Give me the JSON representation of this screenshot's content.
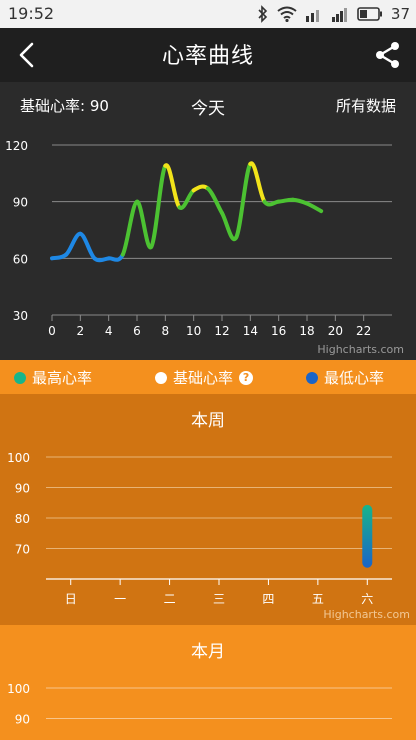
{
  "status": {
    "time": "19:52",
    "battery": "37"
  },
  "header": {
    "title": "心率曲线"
  },
  "summary": {
    "base_label": "基础心率: 90",
    "today_label": "今天",
    "all_data_label": "所有数据"
  },
  "legend": {
    "max_label": "最高心率",
    "base_label": "基础心率",
    "min_label": "最低心率",
    "help_glyph": "?"
  },
  "credits": {
    "text": "Highcharts.com"
  },
  "colors": {
    "accent": "#f4901e",
    "max": "#18b58a",
    "min": "#1a64c8",
    "line_blue": "#1e88e5",
    "line_green": "#4cc232",
    "line_yellow": "#f2e31a"
  },
  "chart_data": [
    {
      "type": "line",
      "title": "",
      "xlabel": "",
      "ylabel": "",
      "xlim": [
        0,
        24
      ],
      "ylim": [
        30,
        120
      ],
      "xticks": [
        0,
        2,
        4,
        6,
        8,
        10,
        12,
        14,
        16,
        18,
        20,
        22
      ],
      "yticks": [
        30,
        60,
        90,
        120
      ],
      "grid": true,
      "x": [
        0,
        1,
        2,
        3,
        4,
        5,
        6,
        7,
        8,
        9,
        10,
        11,
        12,
        13,
        14,
        15,
        16,
        17,
        18,
        19
      ],
      "y": [
        60,
        62,
        73,
        60,
        60,
        62,
        90,
        66,
        109,
        87,
        96,
        97,
        84,
        71,
        110,
        90,
        90,
        91,
        89,
        85
      ]
    },
    {
      "type": "bar",
      "title": "本周",
      "categories": [
        "日",
        "一",
        "二",
        "三",
        "四",
        "五",
        "六"
      ],
      "ylim": [
        60,
        100
      ],
      "yticks": [
        70,
        80,
        90,
        100
      ],
      "grid": true,
      "low": [
        null,
        null,
        null,
        null,
        null,
        null,
        65
      ],
      "high": [
        null,
        null,
        null,
        null,
        null,
        null,
        83
      ]
    },
    {
      "type": "bar",
      "title": "本月",
      "yticks": [
        90,
        100
      ],
      "grid": true
    }
  ]
}
